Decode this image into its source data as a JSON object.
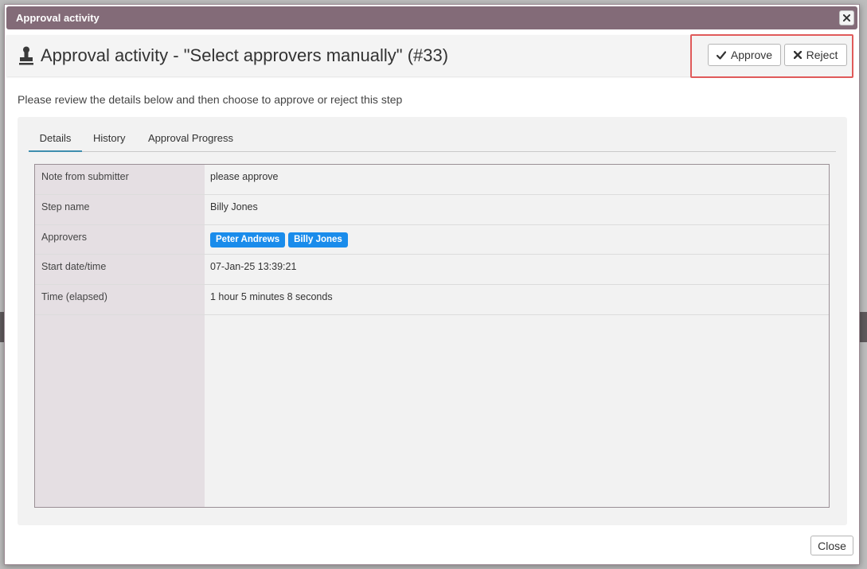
{
  "dialog": {
    "title": "Approval activity",
    "close_glyph": "×"
  },
  "header": {
    "icon": "stamp-icon",
    "title": "Approval activity - \"Select approvers manually\" (#33)",
    "approve_label": "Approve",
    "reject_label": "Reject"
  },
  "instruction": "Please review the details below and then choose to approve or reject this step",
  "tabs": [
    {
      "label": "Details",
      "active": true
    },
    {
      "label": "History",
      "active": false
    },
    {
      "label": "Approval Progress",
      "active": false
    }
  ],
  "details": {
    "note_label": "Note from submitter",
    "note_value": "please approve",
    "step_label": "Step name",
    "step_value": "Billy Jones",
    "approvers_label": "Approvers",
    "approvers": [
      "Peter Andrews",
      "Billy Jones"
    ],
    "start_label": "Start date/time",
    "start_value": "07-Jan-25 13:39:21",
    "elapsed_label": "Time (elapsed)",
    "elapsed_value": "1 hour 5 minutes 8 seconds"
  },
  "footer": {
    "close_label": "Close"
  },
  "colors": {
    "titlebar": "#836b78",
    "chip": "#1a8ceb",
    "highlight": "#e05a5a",
    "active_tab": "#3f8eae"
  }
}
